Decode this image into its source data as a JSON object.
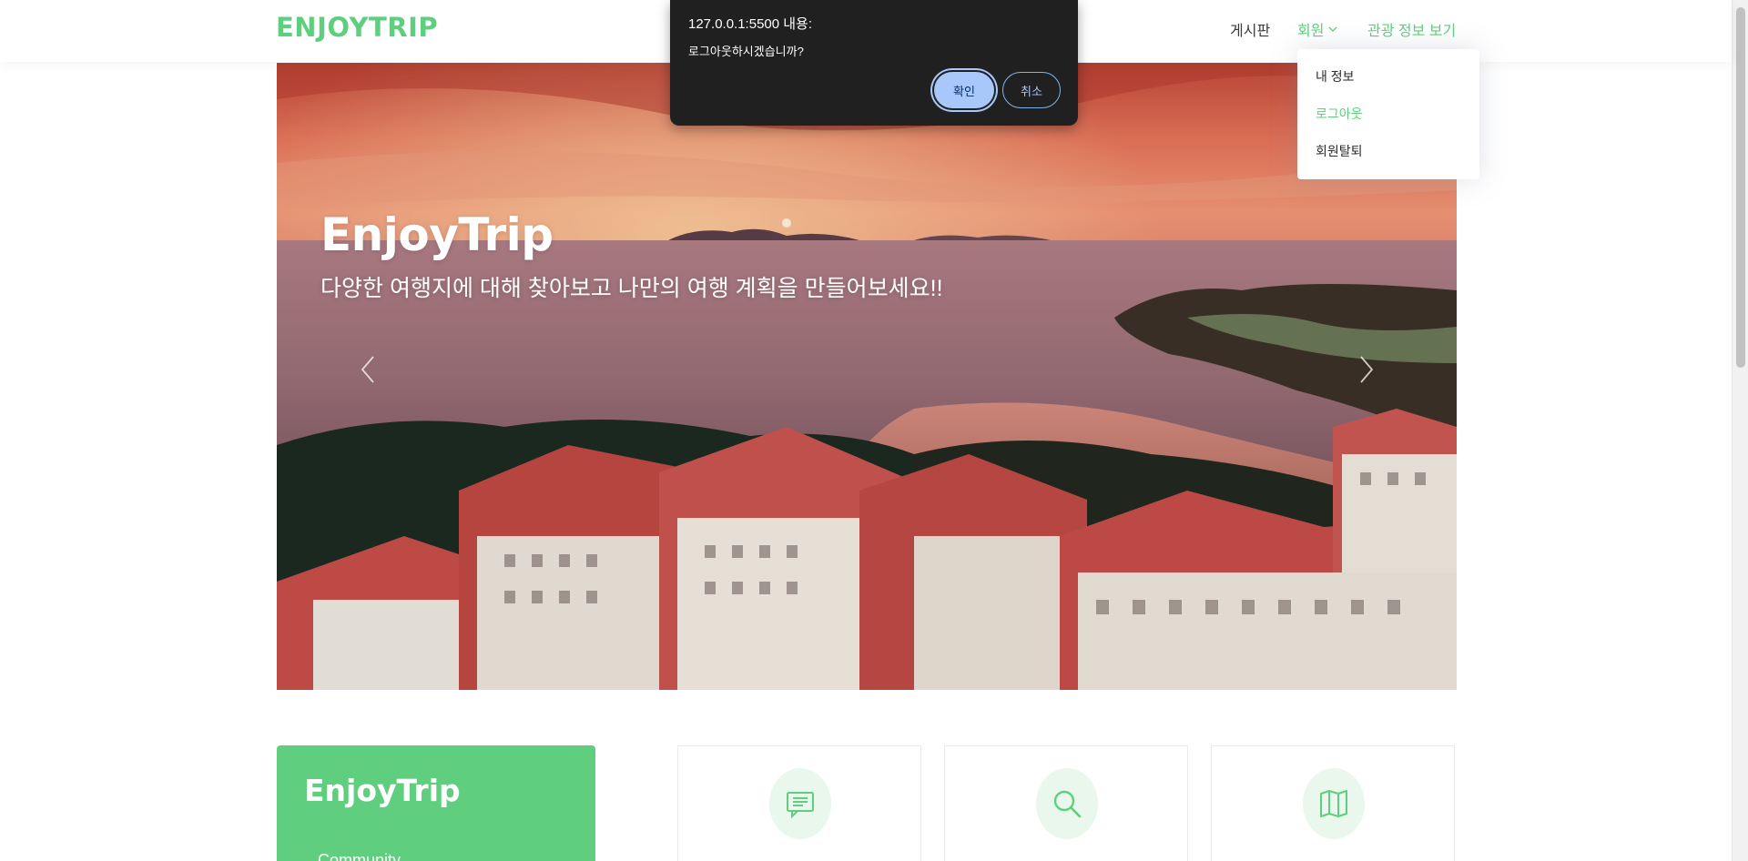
{
  "header": {
    "logo": "ENJOYTRIP",
    "nav": {
      "board": "게시판",
      "member": "회원",
      "tour": "관광 정보 보기"
    },
    "member_menu": [
      "내 정보",
      "로그아웃",
      "회원탈퇴"
    ],
    "active_menu_item": "로그아웃"
  },
  "hero": {
    "title": "EnjoyTrip",
    "subtitle": "다양한 여행지에 대해 찾아보고 나만의 여행 계획을 만들어보세요!!"
  },
  "about": {
    "title": "EnjoyTrip",
    "link": "Community"
  },
  "features": [
    {
      "icon": "chat-icon"
    },
    {
      "icon": "search-icon"
    },
    {
      "icon": "map-icon"
    }
  ],
  "alert": {
    "origin": "127.0.0.1:5500 내용:",
    "message": "로그아웃하시겠습니까?",
    "ok": "확인",
    "cancel": "취소"
  },
  "colors": {
    "accent": "#5fcf7f",
    "dialog_bg": "#202020",
    "dialog_button": "#a8c7fa"
  }
}
